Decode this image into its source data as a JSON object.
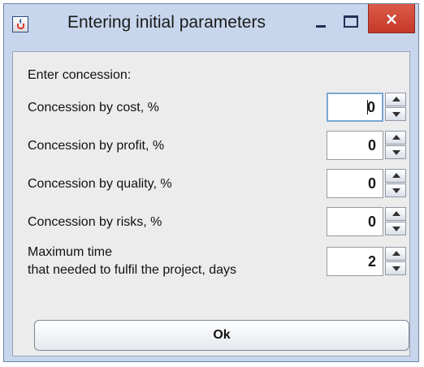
{
  "window": {
    "title": "Entering initial parameters",
    "icon": "java-icon"
  },
  "titlebar_buttons": {
    "minimize": "minimize-icon",
    "maximize": "maximize-icon",
    "close_label": "×"
  },
  "colors": {
    "frame": "#c7d6ec",
    "close": "#d04a3a",
    "focus": "#7aa7d6"
  },
  "form": {
    "heading": "Enter concession:",
    "fields": [
      {
        "label": "Concession by cost, %",
        "value": "0",
        "focused": true
      },
      {
        "label": "Concession by profit, %",
        "value": "0"
      },
      {
        "label": "Concession by quality, %",
        "value": "0"
      },
      {
        "label": "Concession by risks, %",
        "value": "0"
      },
      {
        "label_line1": "Maximum time",
        "label_line2": "that needed to fulfil the project, days",
        "value": "2"
      }
    ]
  },
  "ok_label": "Ok"
}
